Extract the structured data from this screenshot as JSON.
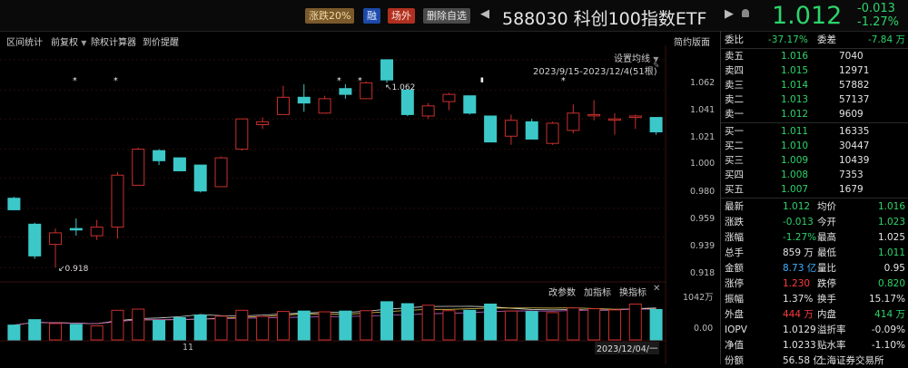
{
  "header": {
    "tags": [
      "涨跌20%",
      "融",
      "场外",
      "删除自选"
    ],
    "nav_prev": "◀",
    "nav_next": "▶",
    "title": "588030  科创100指数ETF",
    "price": "1.012",
    "change": "-0.013",
    "change_pct": "-1.27%"
  },
  "toolbar": {
    "items": [
      "区间统计",
      "前复权",
      "除权计算器",
      "到价提醒"
    ],
    "view_toggle": "简约版面",
    "ma_setting": "设置均线",
    "range": "2023/9/15-2023/12/4(51根)"
  },
  "chart": {
    "ylabels": [
      "1.062",
      "1.041",
      "1.021",
      "1.000",
      "0.980",
      "0.959",
      "0.939",
      "0.918"
    ],
    "ylabel_values": [
      1.062,
      1.041,
      1.021,
      1.0,
      0.98,
      0.959,
      0.939,
      0.918
    ],
    "ylim": [
      0.908,
      1.072
    ],
    "high_label": "1.062",
    "low_label": "0.918",
    "markers": [
      "*",
      "*",
      "*",
      "*",
      "▮",
      "*"
    ],
    "vol_tools": [
      "改参数",
      "加指标",
      "换指标"
    ],
    "vol_close": "✕",
    "vol_ylabels": [
      "1042万",
      "0.00"
    ],
    "x_label": "11",
    "date_label": "2023/12/04/一",
    "candles": [
      {
        "o": 0.966,
        "h": 0.967,
        "l": 0.958,
        "c": 0.958
      },
      {
        "o": 0.948,
        "h": 0.949,
        "l": 0.924,
        "c": 0.926
      },
      {
        "o": 0.934,
        "h": 0.945,
        "l": 0.918,
        "c": 0.942
      },
      {
        "o": 0.945,
        "h": 0.952,
        "l": 0.94,
        "c": 0.944
      },
      {
        "o": 0.94,
        "h": 0.951,
        "l": 0.937,
        "c": 0.946
      },
      {
        "o": 0.946,
        "h": 0.984,
        "l": 0.938,
        "c": 0.982
      },
      {
        "o": 0.975,
        "h": 1.001,
        "l": 0.975,
        "c": 1.0
      },
      {
        "o": 0.999,
        "h": 1.0,
        "l": 0.989,
        "c": 0.992
      },
      {
        "o": 0.994,
        "h": 0.994,
        "l": 0.985,
        "c": 0.985
      },
      {
        "o": 0.989,
        "h": 0.989,
        "l": 0.97,
        "c": 0.971
      },
      {
        "o": 0.974,
        "h": 0.995,
        "l": 0.974,
        "c": 0.994
      },
      {
        "o": 1.0,
        "h": 1.021,
        "l": 0.999,
        "c": 1.021
      },
      {
        "o": 1.017,
        "h": 1.022,
        "l": 1.014,
        "c": 1.019
      },
      {
        "o": 1.024,
        "h": 1.044,
        "l": 1.024,
        "c": 1.036
      },
      {
        "o": 1.036,
        "h": 1.045,
        "l": 1.026,
        "c": 1.032
      },
      {
        "o": 1.025,
        "h": 1.037,
        "l": 1.025,
        "c": 1.035
      },
      {
        "o": 1.042,
        "h": 1.045,
        "l": 1.035,
        "c": 1.038
      },
      {
        "o": 1.035,
        "h": 1.047,
        "l": 1.035,
        "c": 1.046
      },
      {
        "o": 1.062,
        "h": 1.062,
        "l": 1.046,
        "c": 1.048
      },
      {
        "o": 1.041,
        "h": 1.041,
        "l": 1.023,
        "c": 1.024
      },
      {
        "o": 1.023,
        "h": 1.032,
        "l": 1.021,
        "c": 1.03
      },
      {
        "o": 1.033,
        "h": 1.039,
        "l": 1.027,
        "c": 1.038
      },
      {
        "o": 1.037,
        "h": 1.037,
        "l": 1.024,
        "c": 1.025
      },
      {
        "o": 1.023,
        "h": 1.023,
        "l": 1.005,
        "c": 1.005
      },
      {
        "o": 1.009,
        "h": 1.024,
        "l": 1.003,
        "c": 1.02
      },
      {
        "o": 1.019,
        "h": 1.021,
        "l": 1.007,
        "c": 1.007
      },
      {
        "o": 1.004,
        "h": 1.019,
        "l": 1.003,
        "c": 1.018
      },
      {
        "o": 1.013,
        "h": 1.031,
        "l": 1.011,
        "c": 1.025
      },
      {
        "o": 1.024,
        "h": 1.034,
        "l": 1.02,
        "c": 1.024
      },
      {
        "o": 1.021,
        "h": 1.025,
        "l": 1.01,
        "c": 1.021
      },
      {
        "o": 1.022,
        "h": 1.024,
        "l": 1.014,
        "c": 1.023
      },
      {
        "o": 1.022,
        "h": 1.022,
        "l": 1.01,
        "c": 1.012
      }
    ],
    "volumes": [
      0.38,
      0.52,
      0.42,
      0.4,
      0.36,
      0.76,
      0.79,
      0.5,
      0.57,
      0.64,
      0.61,
      0.76,
      0.6,
      0.73,
      0.74,
      0.72,
      0.74,
      0.75,
      0.98,
      0.93,
      0.89,
      0.75,
      0.76,
      0.92,
      0.74,
      0.73,
      0.7,
      0.82,
      0.8,
      0.77,
      0.92,
      0.78
    ],
    "up_color": "#c9302c",
    "down_color": "#3cc8c8"
  },
  "orderbook": {
    "ratio_label": "委比",
    "ratio": "-37.17%",
    "diff_label": "委差",
    "diff": "-7.84 万",
    "asks": [
      {
        "label": "卖五",
        "price": "1.016",
        "vol": "7040"
      },
      {
        "label": "卖四",
        "price": "1.015",
        "vol": "12971"
      },
      {
        "label": "卖三",
        "price": "1.014",
        "vol": "57882"
      },
      {
        "label": "卖二",
        "price": "1.013",
        "vol": "57137"
      },
      {
        "label": "卖一",
        "price": "1.012",
        "vol": "9609"
      }
    ],
    "bids": [
      {
        "label": "买一",
        "price": "1.011",
        "vol": "16335"
      },
      {
        "label": "买二",
        "price": "1.010",
        "vol": "30447"
      },
      {
        "label": "买三",
        "price": "1.009",
        "vol": "10439"
      },
      {
        "label": "买四",
        "price": "1.008",
        "vol": "7353"
      },
      {
        "label": "买五",
        "price": "1.007",
        "vol": "1679"
      }
    ]
  },
  "stats": [
    {
      "l1": "最新",
      "v1": "1.012",
      "c1": "green",
      "l2": "均价",
      "v2": "1.016",
      "c2": "green"
    },
    {
      "l1": "涨跌",
      "v1": "-0.013",
      "c1": "green",
      "l2": "今开",
      "v2": "1.023",
      "c2": "green"
    },
    {
      "l1": "涨幅",
      "v1": "-1.27%",
      "c1": "green",
      "l2": "最高",
      "v2": "1.025",
      "c2": "wht"
    },
    {
      "l1": "总手",
      "v1": "859 万",
      "c1": "wht",
      "l2": "最低",
      "v2": "1.011",
      "c2": "green"
    },
    {
      "l1": "金额",
      "v1": "8.73 亿",
      "c1": "ltblue",
      "l2": "量比",
      "v2": "0.95",
      "c2": "wht"
    },
    {
      "l1": "涨停",
      "v1": "1.230",
      "c1": "red",
      "l2": "跌停",
      "v2": "0.820",
      "c2": "green"
    },
    {
      "l1": "振幅",
      "v1": "1.37%",
      "c1": "wht",
      "l2": "换手",
      "v2": "15.17%",
      "c2": "wht"
    },
    {
      "l1": "外盘",
      "v1": "444 万",
      "c1": "red",
      "l2": "内盘",
      "v2": "414 万",
      "c2": "green"
    },
    {
      "l1": "IOPV",
      "v1": "1.0129",
      "c1": "wht",
      "l2": "溢折率",
      "v2": "-0.09%",
      "c2": "wht"
    },
    {
      "l1": "净值",
      "v1": "1.0233",
      "c1": "wht",
      "l2": "贴水率",
      "v2": "-1.10%",
      "c2": "wht"
    },
    {
      "l1": "份额",
      "v1": "56.58 亿",
      "c1": "wht",
      "l2": "上海证券交易所",
      "v2": "",
      "c2": "wht"
    }
  ]
}
